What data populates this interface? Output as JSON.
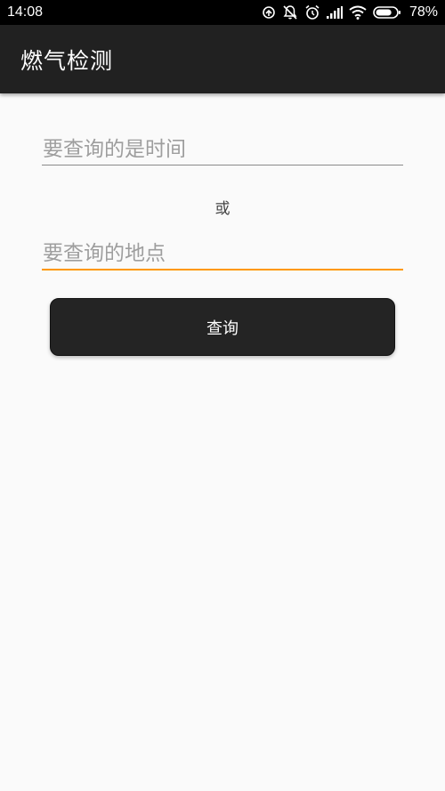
{
  "status_bar": {
    "time": "14:08",
    "icons": [
      "sync-icon",
      "notifications-off-icon",
      "alarm-icon",
      "cell-signal-icon",
      "wifi-icon",
      "battery-icon"
    ],
    "battery_level": 0.78,
    "battery_text": "78%"
  },
  "app_bar": {
    "title": "燃气检测"
  },
  "form": {
    "time_input": {
      "value": "",
      "placeholder": "要查询的是时间"
    },
    "or_label": "或",
    "place_input": {
      "value": "",
      "placeholder": "要查询的地点"
    },
    "query_button_label": "查询"
  },
  "colors": {
    "app_bar": "#212121",
    "accent": "#ff9800",
    "button": "#242424",
    "background": "#fafafa"
  }
}
